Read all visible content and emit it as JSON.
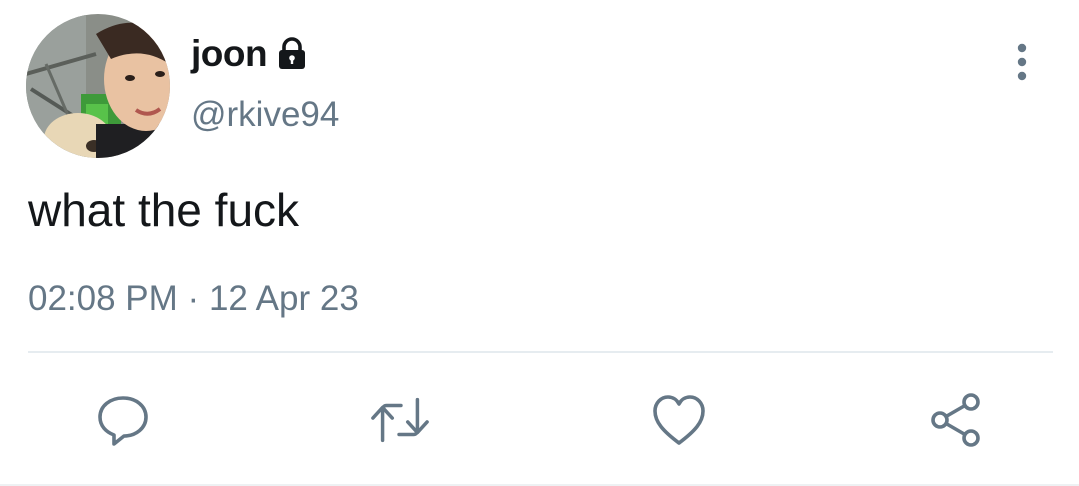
{
  "tweet": {
    "display_name": "joon",
    "handle": "@rkive94",
    "text": "what the fuck",
    "time": "02:08 PM",
    "separator": "·",
    "date": "12 Apr 23",
    "protected": true
  },
  "icons": {
    "lock": "lock-icon",
    "more": "more-vertical-icon",
    "reply": "reply-icon",
    "retweet": "retweet-icon",
    "like": "heart-icon",
    "share": "share-icon"
  },
  "colors": {
    "primary_text": "#14171a",
    "secondary_text": "#657786",
    "icon": "#657786",
    "divider": "#e6ecf0"
  }
}
